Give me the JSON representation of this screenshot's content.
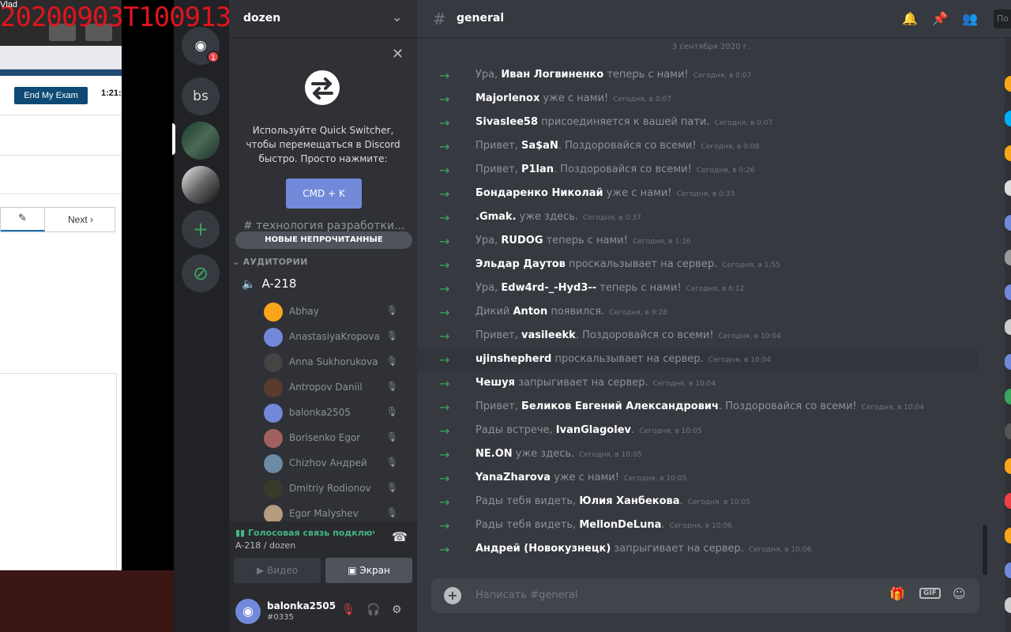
{
  "watermark": "20200903T100913",
  "browser": {
    "top_left_label": "Vlad",
    "end_exam_label": "End My Exam",
    "timer": "1:21:",
    "edit_icon": "✎",
    "next_label": "Next"
  },
  "rail": {
    "home_badge": "1",
    "server_bs": "bs",
    "add_symbol": "+",
    "explore_symbol": "⊘"
  },
  "sidebar": {
    "server_name": "dozen",
    "quick_switcher_text": "Используйте Quick Switcher, чтобы перемещаться в Discord быстро. Просто нажмите:",
    "quick_switcher_button": "CMD + K",
    "faded_channel": "# технология разработки...",
    "new_unread": "НОВЫЕ НЕПРОЧИТАННЫЕ",
    "category": "АУДИТОРИИ",
    "voice_channel": "A-218",
    "voice_users": [
      {
        "name": "Abhay",
        "color": "#faa61a"
      },
      {
        "name": "AnastasiyaKropova",
        "color": "#7289da"
      },
      {
        "name": "Anna Sukhorukova",
        "color": "#444"
      },
      {
        "name": "Antropov Daniil",
        "color": "#5a3b2e"
      },
      {
        "name": "balonka2505",
        "color": "#7289da"
      },
      {
        "name": "Borisenko Egor",
        "color": "#a06060"
      },
      {
        "name": "Chizhov Андрей",
        "color": "#6d8aa5"
      },
      {
        "name": "Dmitriy Rodionov",
        "color": "#3a3a2a"
      },
      {
        "name": "Egor Malyshev",
        "color": "#b59b80"
      }
    ],
    "voice_status": "Голосовая связь подключ",
    "voice_sub": "A-218 / dozen",
    "video_label": "Видео",
    "screen_label": "Экран",
    "username": "balonka2505",
    "usertag": "#0335"
  },
  "main": {
    "channel_name": "general",
    "search_placeholder": "По",
    "date_divider": "3 сентября 2020 г.",
    "messages": [
      {
        "pre": "Ура, ",
        "name": "Иван Логвиненко",
        "post": " теперь с нами!",
        "ts": "Сегодня, в 0:07"
      },
      {
        "pre": "",
        "name": "Majorlenox",
        "post": " уже с нами!",
        "ts": "Сегодня, в 0:07"
      },
      {
        "pre": "",
        "name": "Sivaslee58",
        "post": " присоединяется к вашей пати.",
        "ts": "Сегодня, в 0:07"
      },
      {
        "pre": "Привет, ",
        "name": "Sa$aN",
        "post": ". Поздоровайся со всеми!",
        "ts": "Сегодня, в 0:08"
      },
      {
        "pre": "Привет, ",
        "name": "P1lan",
        "post": ". Поздоровайся со всеми!",
        "ts": "Сегодня, в 0:26"
      },
      {
        "pre": "",
        "name": "Бондаренко Николай",
        "post": " уже с нами!",
        "ts": "Сегодня, в 0:33"
      },
      {
        "pre": "",
        "name": ".Gmak.",
        "post": " уже здесь.",
        "ts": "Сегодня, в 0:37"
      },
      {
        "pre": "Ура, ",
        "name": "RUDOG",
        "post": " теперь с нами!",
        "ts": "Сегодня, в 1:16"
      },
      {
        "pre": "",
        "name": "Эльдар Даутов",
        "post": " проскальзывает на сервер.",
        "ts": "Сегодня, в 1:55"
      },
      {
        "pre": "Ура, ",
        "name": "Edw4rd-_-Hyd3--",
        "post": " теперь с нами!",
        "ts": "Сегодня, в 6:12"
      },
      {
        "pre": "Дикий ",
        "name": "Anton",
        "post": " появился.",
        "ts": "Сегодня, в 9:28"
      },
      {
        "pre": "Привет, ",
        "name": "vasileekk",
        "post": ". Поздоровайся со всеми!",
        "ts": "Сегодня, в 10:04"
      },
      {
        "pre": "",
        "name": "ujinshepherd",
        "post": " проскальзывает на сервер.",
        "ts": "Сегодня, в 10:04"
      },
      {
        "pre": "",
        "name": "Чешуя",
        "post": " запрыгивает на сервер.",
        "ts": "Сегодня, в 10:04"
      },
      {
        "pre": "Привет, ",
        "name": "Беликов Евгений Александрович",
        "post": ". Поздоровайся со всеми!",
        "ts": "Сегодня, в 10:04"
      },
      {
        "pre": "Рады встрече, ",
        "name": "IvanGlagolev",
        "post": ".",
        "ts": "Сегодня, в 10:05"
      },
      {
        "pre": "",
        "name": "NE.ON",
        "post": " уже здесь.",
        "ts": "Сегодня, в 10:05"
      },
      {
        "pre": "",
        "name": "YanaZharova",
        "post": " уже с нами!",
        "ts": "Сегодня, в 10:05"
      },
      {
        "pre": "Рады тебя видеть, ",
        "name": "Юлия Ханбекова",
        "post": ".",
        "ts": "Сегодня, в 10:05"
      },
      {
        "pre": "Рады тебя видеть, ",
        "name": "MellonDeLuna",
        "post": ".",
        "ts": "Сегодня, в 10:06"
      },
      {
        "pre": "",
        "name": "Андрей (Новокузнецк)",
        "post": " запрыгивает на сервер.",
        "ts": "Сегодня, в 10:06"
      }
    ],
    "compose_placeholder": "Написать #general",
    "gif_label": "GIF"
  },
  "colors": {
    "accent": "#7289da",
    "online": "#43b581",
    "join_arrow": "#3ba55d",
    "member_dots": [
      "#faa61a",
      "#00b0f4",
      "#faa61a",
      "#ddd",
      "#7289da",
      "#999",
      "#7289da",
      "#ccc",
      "#7289da",
      "#3ba55d",
      "#555",
      "#faa61a",
      "#ed4245",
      "#faa61a",
      "#7289da",
      "#ccc"
    ]
  }
}
